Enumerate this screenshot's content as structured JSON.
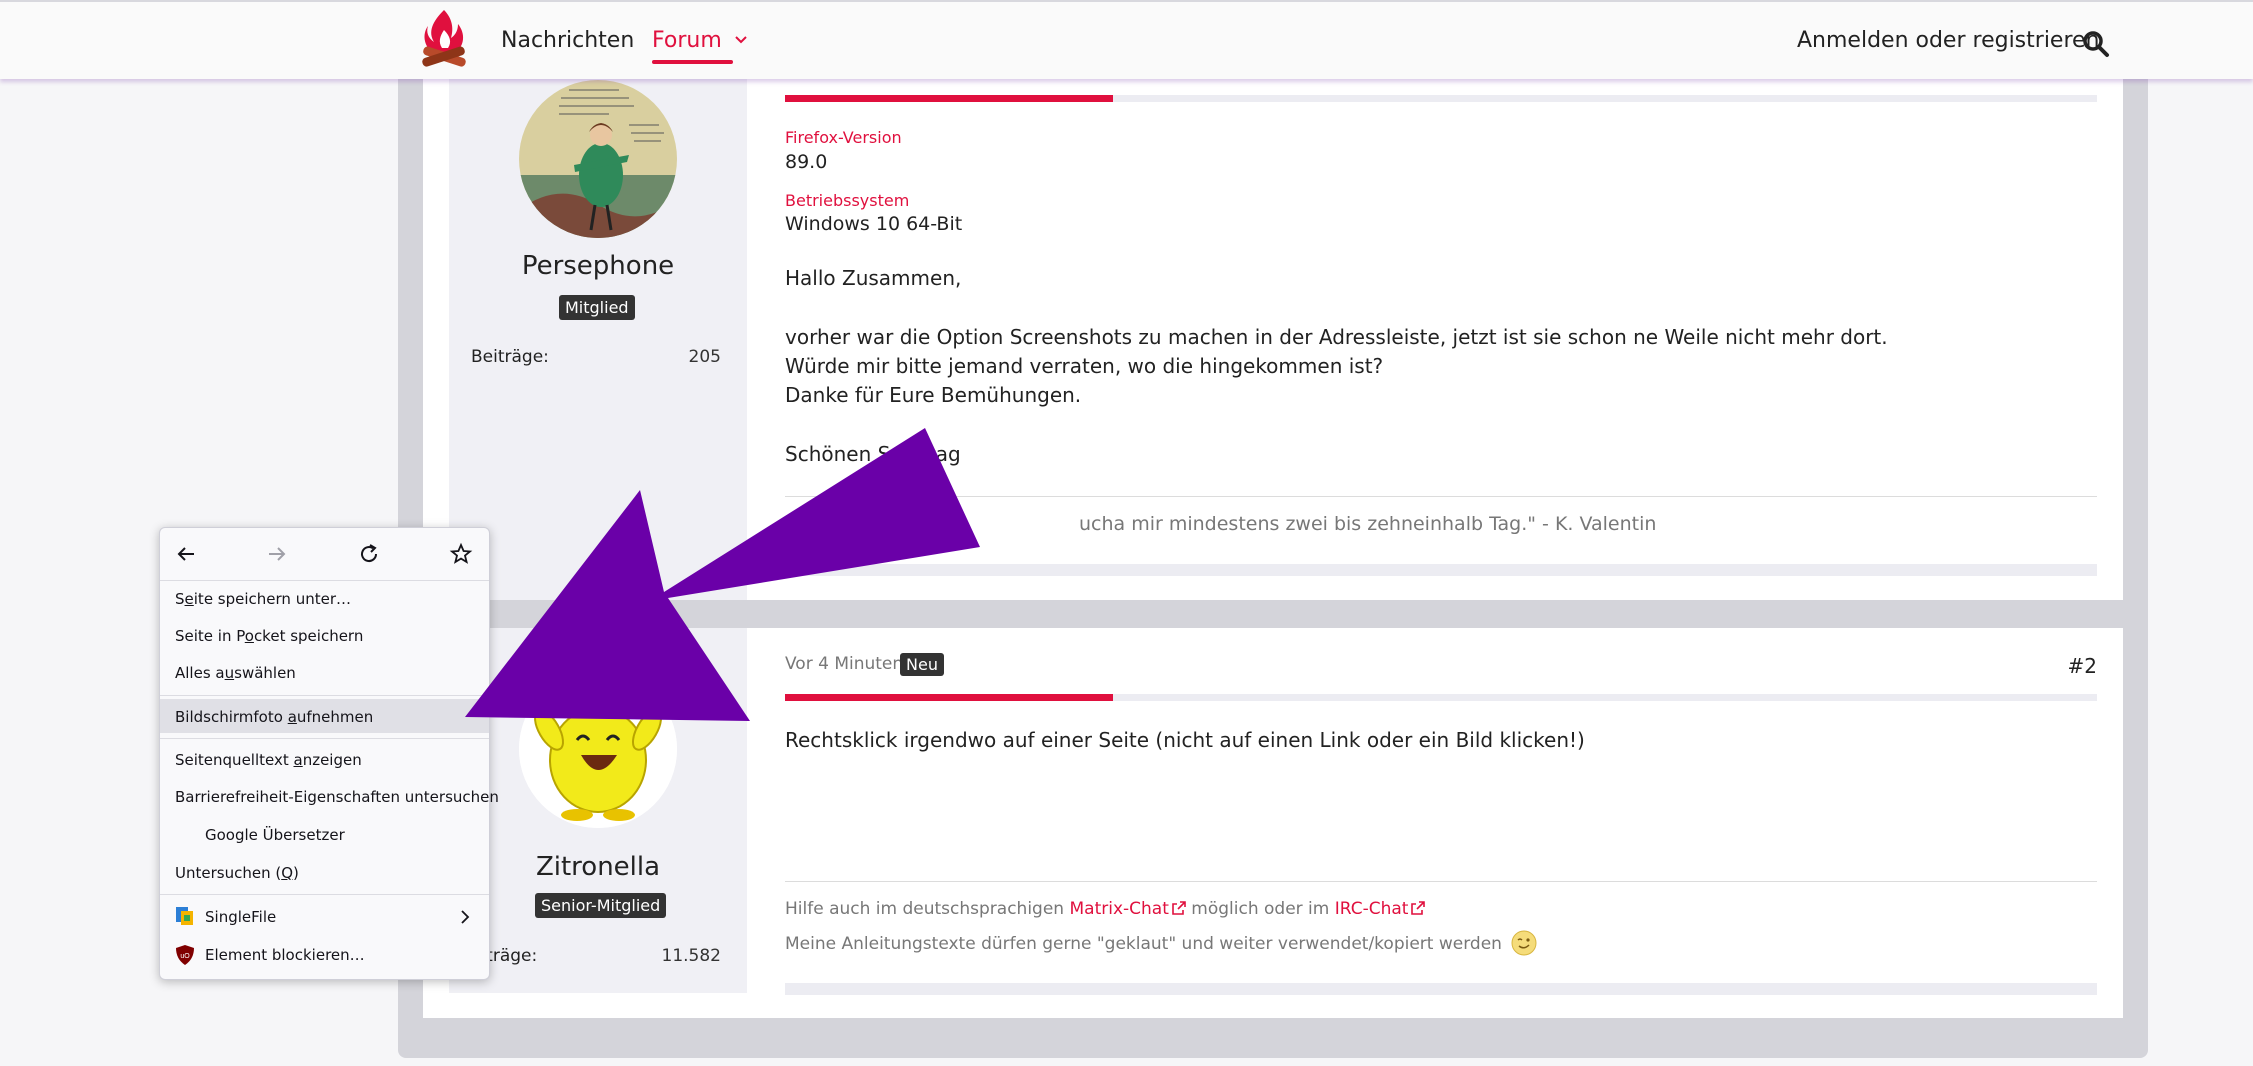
{
  "header": {
    "nav_news": "Nachrichten",
    "nav_forum": "Forum",
    "login_label": "Anmelden oder registrieren",
    "icons": {
      "logo": "campfire-logo",
      "search": "search-icon",
      "dropdown": "chevron-down-icon"
    }
  },
  "post1": {
    "author": "Persephone",
    "rank": "Mitglied",
    "stat_label": "Beiträge",
    "stat_value": "205",
    "fields": [
      {
        "label": "Firefox-Version",
        "value": "89.0"
      },
      {
        "label": "Betriebssystem",
        "value": "Windows 10 64-Bit"
      }
    ],
    "message": {
      "greeting": "Hallo Zusammen,",
      "line1": "vorher war die Option Screenshots zu machen in der Adressleiste, jetzt ist sie schon ne Weile nicht mehr dort.",
      "line2": "Würde mir bitte jemand verraten, wo die hingekommen ist?",
      "line3": "Danke für Eure Bemühungen.",
      "closing": "Schönen Sonntag"
    },
    "signature": "ucha mir mindestens zwei bis zehneinhalb Tag.\" - K. Valentin"
  },
  "post2": {
    "time": "Vor 4 Minuten",
    "badge_new": "Neu",
    "number": "#2",
    "author": "Zitronella",
    "rank": "Senior-Mitglied",
    "stat_label": "eiträge",
    "stat_value": "11.582",
    "message": "Rechtsklick irgendwo auf einer Seite (nicht auf einen Link oder ein Bild klicken!)",
    "signature": {
      "part1": "Hilfe auch im deutschsprachigen",
      "link1": "Matrix-Chat",
      "part2": "möglich oder im",
      "link2": "IRC-Chat",
      "line2": "Meine Anleitungstexte dürfen gerne \"geklaut\" und weiter verwendet/kopiert werden"
    }
  },
  "context_menu": {
    "save_page": {
      "pre": "S",
      "u": "e",
      "post": "ite speichern unter…"
    },
    "save_pocket": {
      "pre": "Seite in P",
      "u": "o",
      "post": "cket speichern"
    },
    "select_all": {
      "pre": "Alles a",
      "u": "u",
      "post": "swählen"
    },
    "screenshot": {
      "pre": "Bildschirmfoto ",
      "u": "a",
      "post": "ufnehmen"
    },
    "view_source": {
      "pre": "Seitenquelltext ",
      "u": "a",
      "post": "nzeigen"
    },
    "accessibility": "Barrierefreiheit-Eigenschaften untersuchen",
    "translate": "Google Übersetzer",
    "inspect": {
      "pre": "Untersuchen (",
      "u": "Q",
      "post": ")"
    },
    "singlefile": "SingleFile",
    "block_element": "Element blockieren…"
  },
  "colors": {
    "accent": "#e0103e",
    "arrow": "#6a00a8"
  }
}
